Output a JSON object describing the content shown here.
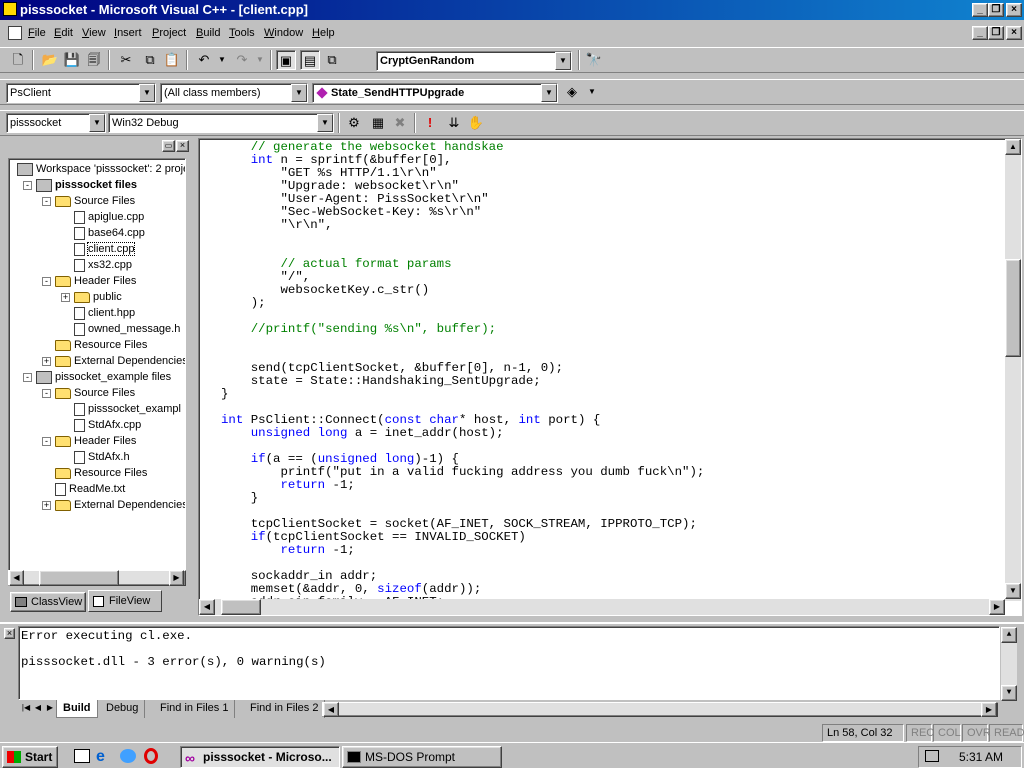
{
  "window": {
    "title": "pisssocket - Microsoft Visual C++ - [client.cpp]"
  },
  "menu": [
    "File",
    "Edit",
    "View",
    "Insert",
    "Project",
    "Build",
    "Tools",
    "Window",
    "Help"
  ],
  "toolbar": {
    "find_combo": "CryptGenRandom"
  },
  "wizardbar": {
    "class": "PsClient",
    "filter": "(All class members)",
    "member": "State_SendHTTPUpgrade"
  },
  "buildbar": {
    "project": "pisssocket",
    "config": "Win32 Debug"
  },
  "workspace": {
    "tree": [
      {
        "label": "Workspace 'pisssocket': 2 proje",
        "type": "workspace",
        "level": 0
      },
      {
        "label": "pisssocket files",
        "type": "project",
        "level": 1,
        "bold": true,
        "exp": "-"
      },
      {
        "label": "Source Files",
        "type": "folder",
        "level": 2,
        "exp": "-"
      },
      {
        "label": "apiglue.cpp",
        "type": "file",
        "level": 3
      },
      {
        "label": "base64.cpp",
        "type": "file",
        "level": 3
      },
      {
        "label": "client.cpp",
        "type": "file",
        "level": 3,
        "selected": true
      },
      {
        "label": "xs32.cpp",
        "type": "file",
        "level": 3
      },
      {
        "label": "Header Files",
        "type": "folder",
        "level": 2,
        "exp": "-"
      },
      {
        "label": "public",
        "type": "folder",
        "level": 3,
        "exp": "+"
      },
      {
        "label": "client.hpp",
        "type": "file",
        "level": 3
      },
      {
        "label": "owned_message.h",
        "type": "file",
        "level": 3
      },
      {
        "label": "Resource Files",
        "type": "folder",
        "level": 2
      },
      {
        "label": "External Dependencies",
        "type": "folder",
        "level": 2,
        "exp": "+"
      },
      {
        "label": "pissocket_example files",
        "type": "project",
        "level": 1,
        "exp": "-"
      },
      {
        "label": "Source Files",
        "type": "folder",
        "level": 2,
        "exp": "-"
      },
      {
        "label": "pisssocket_exampl",
        "type": "file",
        "level": 3
      },
      {
        "label": "StdAfx.cpp",
        "type": "file",
        "level": 3
      },
      {
        "label": "Header Files",
        "type": "folder",
        "level": 2,
        "exp": "-"
      },
      {
        "label": "StdAfx.h",
        "type": "file",
        "level": 3
      },
      {
        "label": "Resource Files",
        "type": "folder",
        "level": 2
      },
      {
        "label": "ReadMe.txt",
        "type": "file",
        "level": 2
      },
      {
        "label": "External Dependencies",
        "type": "folder",
        "level": 2,
        "exp": "+"
      }
    ],
    "tabs": [
      "ClassView",
      "FileView"
    ]
  },
  "code": [
    [
      [
        "cm",
        "    // generate the websocket handskae"
      ]
    ],
    [
      [
        "kw",
        "    int"
      ],
      [
        "",
        " n = sprintf(&buffer[0],"
      ]
    ],
    [
      [
        "",
        "        \"GET %s HTTP/1.1\\r\\n\""
      ]
    ],
    [
      [
        "",
        "        \"Upgrade: websocket\\r\\n\""
      ]
    ],
    [
      [
        "",
        "        \"User-Agent: PissSocket\\r\\n\""
      ]
    ],
    [
      [
        "",
        "        \"Sec-WebSocket-Key: %s\\r\\n\""
      ]
    ],
    [
      [
        "",
        "        \"\\r\\n\","
      ]
    ],
    [
      [
        "",
        ""
      ]
    ],
    [
      [
        "",
        ""
      ]
    ],
    [
      [
        "cm",
        "        // actual format params"
      ]
    ],
    [
      [
        "",
        "        \"/\","
      ]
    ],
    [
      [
        "",
        "        websocketKey.c_str()"
      ]
    ],
    [
      [
        "",
        "    );"
      ]
    ],
    [
      [
        "",
        ""
      ]
    ],
    [
      [
        "cm",
        "    //printf(\"sending %s\\n\", buffer);"
      ]
    ],
    [
      [
        "",
        ""
      ]
    ],
    [
      [
        "",
        ""
      ]
    ],
    [
      [
        "",
        "    send(tcpClientSocket, &buffer[0], n-1, 0);"
      ]
    ],
    [
      [
        "",
        "    state = State::Handshaking_SentUpgrade;"
      ]
    ],
    [
      [
        "",
        "}"
      ]
    ],
    [
      [
        "",
        ""
      ]
    ],
    [
      [
        "kw",
        "int"
      ],
      [
        "",
        " PsClient::Connect("
      ],
      [
        "kw",
        "const char"
      ],
      [
        "",
        "* host, "
      ],
      [
        "kw",
        "int"
      ],
      [
        "",
        " port) {"
      ]
    ],
    [
      [
        "kw",
        "    unsigned long"
      ],
      [
        "",
        " a = inet_addr(host);"
      ]
    ],
    [
      [
        "",
        ""
      ]
    ],
    [
      [
        "kw",
        "    if"
      ],
      [
        "",
        "(a == ("
      ],
      [
        "kw",
        "unsigned long"
      ],
      [
        "",
        ")-1) {"
      ]
    ],
    [
      [
        "",
        "        printf(\"put in a valid fucking address you dumb fuck\\n\");"
      ]
    ],
    [
      [
        "kw",
        "        return"
      ],
      [
        "",
        " -1;"
      ]
    ],
    [
      [
        "",
        "    }"
      ]
    ],
    [
      [
        "",
        ""
      ]
    ],
    [
      [
        "",
        "    tcpClientSocket = socket(AF_INET, SOCK_STREAM, IPPROTO_TCP);"
      ]
    ],
    [
      [
        "kw",
        "    if"
      ],
      [
        "",
        "(tcpClientSocket == INVALID_SOCKET)"
      ]
    ],
    [
      [
        "kw",
        "        return"
      ],
      [
        "",
        " -1;"
      ]
    ],
    [
      [
        "",
        ""
      ]
    ],
    [
      [
        "",
        "    sockaddr_in addr;"
      ]
    ],
    [
      [
        "",
        "    memset(&addr, 0, "
      ],
      [
        "kw",
        "sizeof"
      ],
      [
        "",
        "(addr));"
      ]
    ],
    [
      [
        "",
        "    addr.sin_family = AF_INET;"
      ]
    ]
  ],
  "output": {
    "lines": [
      "Error executing cl.exe.",
      "",
      "pisssocket.dll - 3 error(s), 0 warning(s)"
    ],
    "tabs": [
      "Build",
      "Debug",
      "Find in Files 1",
      "Find in Files 2"
    ]
  },
  "status": {
    "position": "Ln 58, Col 32",
    "rec": "REC",
    "col": "COL",
    "ovr": "OVR",
    "read": "READ"
  },
  "taskbar": {
    "start": "Start",
    "tasks": [
      "pisssocket - Microso...",
      "MS-DOS Prompt"
    ],
    "clock": "5:31 AM"
  }
}
